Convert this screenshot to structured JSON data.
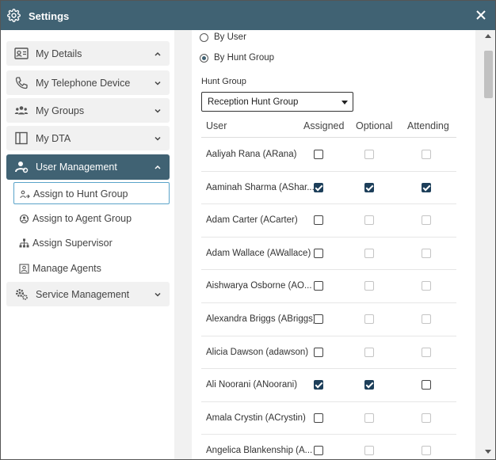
{
  "window": {
    "title": "Settings"
  },
  "sidebar": {
    "items": [
      {
        "label": "My Details",
        "icon": "id-card-icon",
        "expanded": true
      },
      {
        "label": "My Telephone Device",
        "icon": "phone-icon",
        "expanded": false
      },
      {
        "label": "My Groups",
        "icon": "people-icon",
        "expanded": false
      },
      {
        "label": "My DTA",
        "icon": "panel-icon",
        "expanded": false
      },
      {
        "label": "User Management",
        "icon": "user-gear-icon",
        "expanded": true,
        "active": true
      },
      {
        "label": "Service Management",
        "icon": "gears-icon",
        "expanded": false
      }
    ],
    "user_management_sub": [
      {
        "label": "Assign to Hunt Group",
        "icon": "hunt-group-icon",
        "selected": true
      },
      {
        "label": "Assign to Agent Group",
        "icon": "agent-group-icon"
      },
      {
        "label": "Assign Supervisor",
        "icon": "org-chart-icon"
      },
      {
        "label": "Manage Agents",
        "icon": "agent-badge-icon"
      }
    ]
  },
  "filter": {
    "by_user_label": "By User",
    "by_hunt_group_label": "By Hunt Group",
    "selected": "By Hunt Group"
  },
  "hunt_group": {
    "label": "Hunt Group",
    "value": "Reception Hunt Group"
  },
  "table": {
    "headers": {
      "user": "User",
      "assigned": "Assigned",
      "optional": "Optional",
      "attending": "Attending"
    },
    "rows": [
      {
        "user": "Aaliyah Rana (ARana)",
        "assigned": false,
        "optional": false,
        "attending": false,
        "enabled": false
      },
      {
        "user": "Aaminah Sharma (AShar...",
        "assigned": true,
        "optional": true,
        "attending": true,
        "enabled": true
      },
      {
        "user": "Adam Carter (ACarter)",
        "assigned": false,
        "optional": false,
        "attending": false,
        "enabled": false
      },
      {
        "user": "Adam Wallace (AWallace)",
        "assigned": false,
        "optional": false,
        "attending": false,
        "enabled": false
      },
      {
        "user": "Aishwarya Osborne (AO...",
        "assigned": false,
        "optional": false,
        "attending": false,
        "enabled": false
      },
      {
        "user": "Alexandra Briggs (ABriggs)",
        "assigned": false,
        "optional": false,
        "attending": false,
        "enabled": false
      },
      {
        "user": "Alicia Dawson (adawson)",
        "assigned": false,
        "optional": false,
        "attending": false,
        "enabled": false
      },
      {
        "user": "Ali Noorani (ANoorani)",
        "assigned": true,
        "optional": true,
        "attending": false,
        "enabled": true
      },
      {
        "user": "Amala Crystin (ACrystin)",
        "assigned": false,
        "optional": false,
        "attending": false,
        "enabled": false
      },
      {
        "user": "Angelica Blankenship (A...",
        "assigned": false,
        "optional": false,
        "attending": false,
        "enabled": false
      }
    ]
  },
  "colors": {
    "header_bg": "#406273",
    "check_fill": "#1d3f5a",
    "selected_border": "#5aa3c9"
  }
}
